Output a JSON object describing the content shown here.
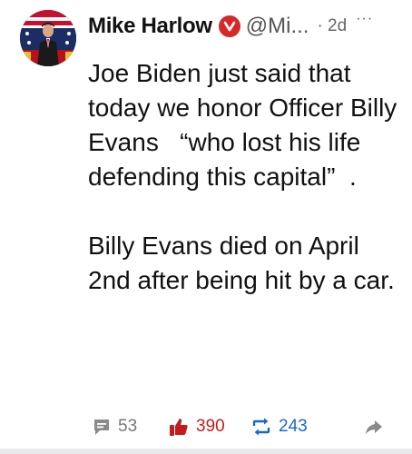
{
  "author": {
    "display_name": "Mike Harlow",
    "handle": "@Mi...",
    "time": "· 2d",
    "more_label": "···",
    "verified_color": "#d62828"
  },
  "post": {
    "paragraphs": [
      "Joe Biden just said that today we honor Officer Billy Evans   “who lost his life defending this capital”  .",
      "Billy Evans died on April 2nd after being hit by a car."
    ]
  },
  "actions": {
    "comments": "53",
    "likes": "390",
    "reposts": "243"
  },
  "icons": {
    "comment": "comment-icon",
    "like": "thumbs-up-icon",
    "repost": "repost-icon",
    "share": "share-arrow-icon",
    "verified": "verified-badge-icon"
  },
  "colors": {
    "like": "#c51b1b",
    "repost": "#1769c9",
    "muted": "#777777"
  }
}
